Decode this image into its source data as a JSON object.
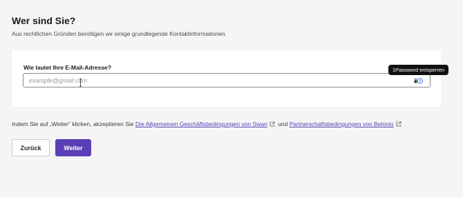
{
  "section": {
    "title": "Wer sind Sie?",
    "subtitle": "Aus rechtlichen Gründen benötigen wir einige grundlegende Kontaktinformationen."
  },
  "email": {
    "label": "Wie lautet Ihre E-Mail-Adresse?",
    "placeholder": "example@gmail.com",
    "value": ""
  },
  "password_manager": {
    "tooltip": "1Password entsperren",
    "icon": "1password-lock-icon"
  },
  "terms": {
    "prefix": "Indem Sie auf „Weiter“ klicken, akzeptieren Sie",
    "link1": "Die Allgemeinen Geschäftsbedingungen von Swan",
    "connector": "und",
    "link2": "Partnerschaftsbedingungen von Belonio",
    "link_icon": "external-link-icon"
  },
  "buttons": {
    "back": "Zurück",
    "next": "Weiter"
  },
  "colors": {
    "accent": "#5a3fb6",
    "background": "#f5f5f5",
    "card": "#ffffff"
  }
}
